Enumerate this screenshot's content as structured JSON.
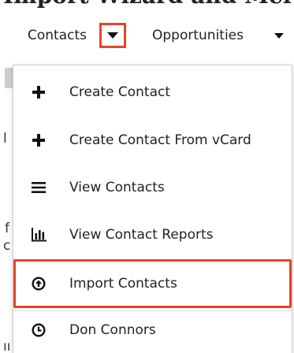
{
  "page": {
    "heading": "Import Wizard and Mer"
  },
  "nav": {
    "contacts_label": "Contacts",
    "opportunities_label": "Opportunities"
  },
  "dropdown": {
    "items": [
      {
        "label": "Create Contact",
        "icon": "plus-icon"
      },
      {
        "label": "Create Contact From vCard",
        "icon": "plus-icon"
      },
      {
        "label": "View Contacts",
        "icon": "list-icon"
      },
      {
        "label": "View Contact Reports",
        "icon": "bar-chart-icon"
      },
      {
        "label": "Import Contacts",
        "icon": "upload-circle-icon"
      },
      {
        "label": "Don Connors",
        "icon": "clock-icon"
      }
    ]
  },
  "colors": {
    "highlight": "#e8432a",
    "text": "#222222",
    "border": "#cfcfcf"
  }
}
